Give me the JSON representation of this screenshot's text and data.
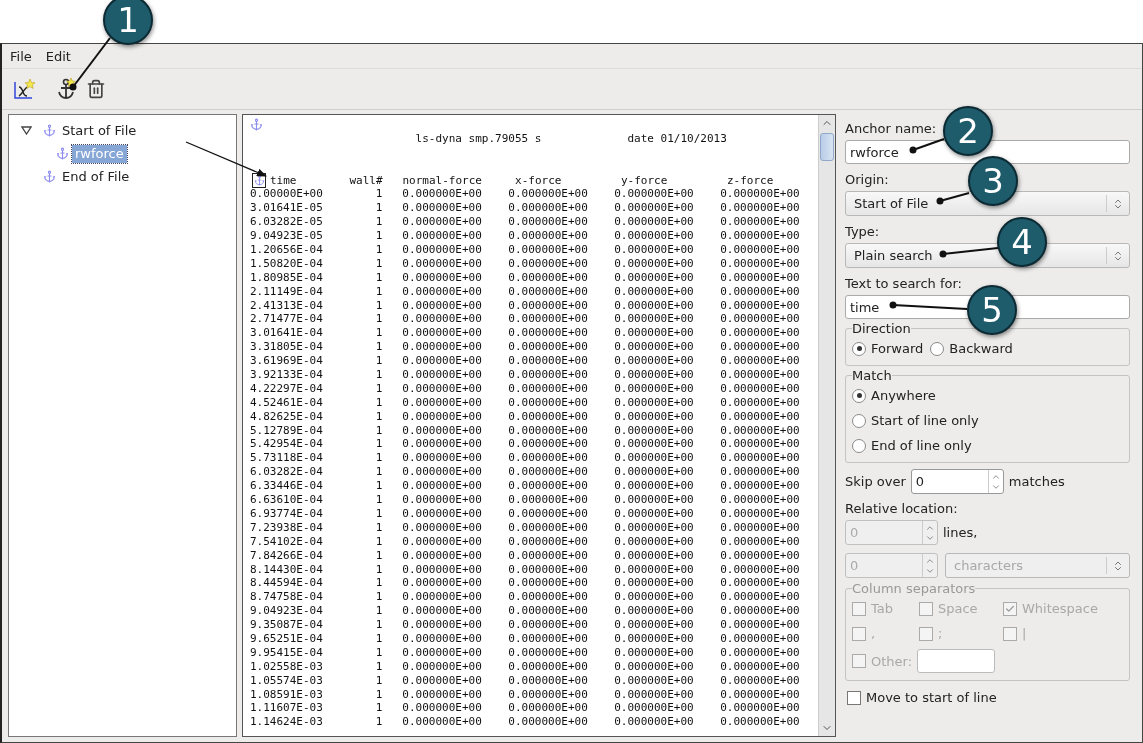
{
  "menu": [
    "File",
    "Edit"
  ],
  "tree": [
    {
      "label": "Start of File",
      "expanded": true,
      "selected": false,
      "children": [
        {
          "label": "rwforce",
          "selected": true
        }
      ]
    },
    {
      "label": "End of File",
      "selected": false
    }
  ],
  "viewer": {
    "header": "                         ls-dyna smp.79055 s             date 01/10/2013",
    "columns": "time        wall#   normal-force     x-force         y-force         z-force",
    "rows": [
      "0.00000E+00        1   0.000000E+00    0.000000E+00    0.000000E+00    0.000000E+00",
      "3.01641E-05        1   0.000000E+00    0.000000E+00    0.000000E+00    0.000000E+00",
      "6.03282E-05        1   0.000000E+00    0.000000E+00    0.000000E+00    0.000000E+00",
      "9.04923E-05        1   0.000000E+00    0.000000E+00    0.000000E+00    0.000000E+00",
      "1.20656E-04        1   0.000000E+00    0.000000E+00    0.000000E+00    0.000000E+00",
      "1.50820E-04        1   0.000000E+00    0.000000E+00    0.000000E+00    0.000000E+00",
      "1.80985E-04        1   0.000000E+00    0.000000E+00    0.000000E+00    0.000000E+00",
      "2.11149E-04        1   0.000000E+00    0.000000E+00    0.000000E+00    0.000000E+00",
      "2.41313E-04        1   0.000000E+00    0.000000E+00    0.000000E+00    0.000000E+00",
      "2.71477E-04        1   0.000000E+00    0.000000E+00    0.000000E+00    0.000000E+00",
      "3.01641E-04        1   0.000000E+00    0.000000E+00    0.000000E+00    0.000000E+00",
      "3.31805E-04        1   0.000000E+00    0.000000E+00    0.000000E+00    0.000000E+00",
      "3.61969E-04        1   0.000000E+00    0.000000E+00    0.000000E+00    0.000000E+00",
      "3.92133E-04        1   0.000000E+00    0.000000E+00    0.000000E+00    0.000000E+00",
      "4.22297E-04        1   0.000000E+00    0.000000E+00    0.000000E+00    0.000000E+00",
      "4.52461E-04        1   0.000000E+00    0.000000E+00    0.000000E+00    0.000000E+00",
      "4.82625E-04        1   0.000000E+00    0.000000E+00    0.000000E+00    0.000000E+00",
      "5.12789E-04        1   0.000000E+00    0.000000E+00    0.000000E+00    0.000000E+00",
      "5.42954E-04        1   0.000000E+00    0.000000E+00    0.000000E+00    0.000000E+00",
      "5.73118E-04        1   0.000000E+00    0.000000E+00    0.000000E+00    0.000000E+00",
      "6.03282E-04        1   0.000000E+00    0.000000E+00    0.000000E+00    0.000000E+00",
      "6.33446E-04        1   0.000000E+00    0.000000E+00    0.000000E+00    0.000000E+00",
      "6.63610E-04        1   0.000000E+00    0.000000E+00    0.000000E+00    0.000000E+00",
      "6.93774E-04        1   0.000000E+00    0.000000E+00    0.000000E+00    0.000000E+00",
      "7.23938E-04        1   0.000000E+00    0.000000E+00    0.000000E+00    0.000000E+00",
      "7.54102E-04        1   0.000000E+00    0.000000E+00    0.000000E+00    0.000000E+00",
      "7.84266E-04        1   0.000000E+00    0.000000E+00    0.000000E+00    0.000000E+00",
      "8.14430E-04        1   0.000000E+00    0.000000E+00    0.000000E+00    0.000000E+00",
      "8.44594E-04        1   0.000000E+00    0.000000E+00    0.000000E+00    0.000000E+00",
      "8.74758E-04        1   0.000000E+00    0.000000E+00    0.000000E+00    0.000000E+00",
      "9.04923E-04        1   0.000000E+00    0.000000E+00    0.000000E+00    0.000000E+00",
      "9.35087E-04        1   0.000000E+00    0.000000E+00    0.000000E+00    0.000000E+00",
      "9.65251E-04        1   0.000000E+00    0.000000E+00    0.000000E+00    0.000000E+00",
      "9.95415E-04        1   0.000000E+00    0.000000E+00    0.000000E+00    0.000000E+00",
      "1.02558E-03        1   0.000000E+00    0.000000E+00    0.000000E+00    0.000000E+00",
      "1.05574E-03        1   0.000000E+00    0.000000E+00    0.000000E+00    0.000000E+00",
      "1.08591E-03        1   0.000000E+00    0.000000E+00    0.000000E+00    0.000000E+00",
      "1.11607E-03        1   0.000000E+00    0.000000E+00    0.000000E+00    0.000000E+00",
      "1.14624E-03        1   0.000000E+00    0.000000E+00    0.000000E+00    0.000000E+00"
    ]
  },
  "form": {
    "anchor_name": {
      "label": "Anchor name:",
      "value": "rwforce"
    },
    "origin": {
      "label": "Origin:",
      "value": "Start of File"
    },
    "type": {
      "label": "Type:",
      "value": "Plain search"
    },
    "search_text": {
      "label": "Text to search for:",
      "value": "time"
    },
    "direction": {
      "title": "Direction",
      "options": [
        {
          "label": "Forward",
          "selected": true
        },
        {
          "label": "Backward",
          "selected": false
        }
      ]
    },
    "match": {
      "title": "Match",
      "options": [
        {
          "label": "Anywhere",
          "selected": true
        },
        {
          "label": "Start of line only",
          "selected": false
        },
        {
          "label": "End of line only",
          "selected": false
        }
      ]
    },
    "skip": {
      "label": "Skip over",
      "value": "0",
      "suffix": "matches"
    },
    "relative": {
      "label": "Relative location:",
      "disabled": true,
      "lines": {
        "value": "0",
        "suffix": "lines,"
      },
      "chars": {
        "value": "0",
        "unit": "characters"
      }
    },
    "column_separators": {
      "title": "Column separators",
      "disabled": true,
      "options": [
        {
          "label": "Tab",
          "checked": false
        },
        {
          "label": "Space",
          "checked": false
        },
        {
          "label": "Whitespace",
          "checked": true
        },
        {
          "label": ",",
          "checked": false
        },
        {
          "label": ";",
          "checked": false
        },
        {
          "label": "|",
          "checked": false
        }
      ],
      "other": {
        "label": "Other:",
        "checked": false
      }
    },
    "move_to_start": {
      "label": "Move to start of line",
      "checked": false
    }
  },
  "callouts": [
    "1",
    "2",
    "3",
    "4",
    "5"
  ]
}
